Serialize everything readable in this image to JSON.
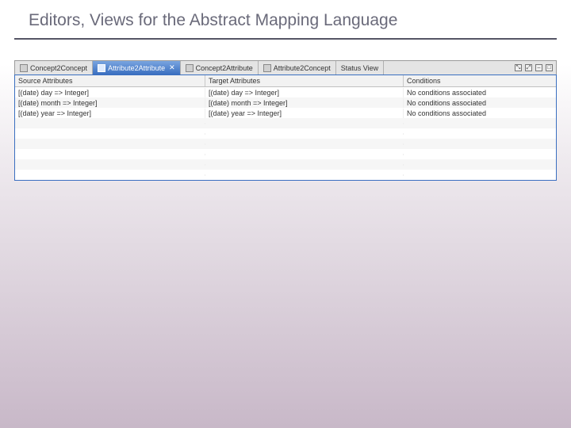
{
  "title": "Editors, Views for the Abstract Mapping Language",
  "tabs": [
    {
      "label": "Concept2Concept",
      "active": false,
      "closable": false
    },
    {
      "label": "Attribute2Attribute",
      "active": true,
      "closable": true
    },
    {
      "label": "Concept2Attribute",
      "active": false,
      "closable": false
    },
    {
      "label": "Attribute2Concept",
      "active": false,
      "closable": false
    },
    {
      "label": "Status View",
      "active": false,
      "closable": false
    }
  ],
  "columns": {
    "source": "Source Attributes",
    "target": "Target Attributes",
    "conditions": "Conditions"
  },
  "rows": [
    {
      "source": "[(date) day => Integer]",
      "target": "[(date) day => Integer]",
      "conditions": "No conditions associated"
    },
    {
      "source": "[(date) month => Integer]",
      "target": "[(date) month => Integer]",
      "conditions": "No conditions associated"
    },
    {
      "source": "[(date) year => Integer]",
      "target": "[(date) year => Integer]",
      "conditions": "No conditions associated"
    }
  ],
  "actions": {
    "a1": "⤡",
    "a2": "⤢",
    "a3": "–",
    "a4": "□"
  }
}
